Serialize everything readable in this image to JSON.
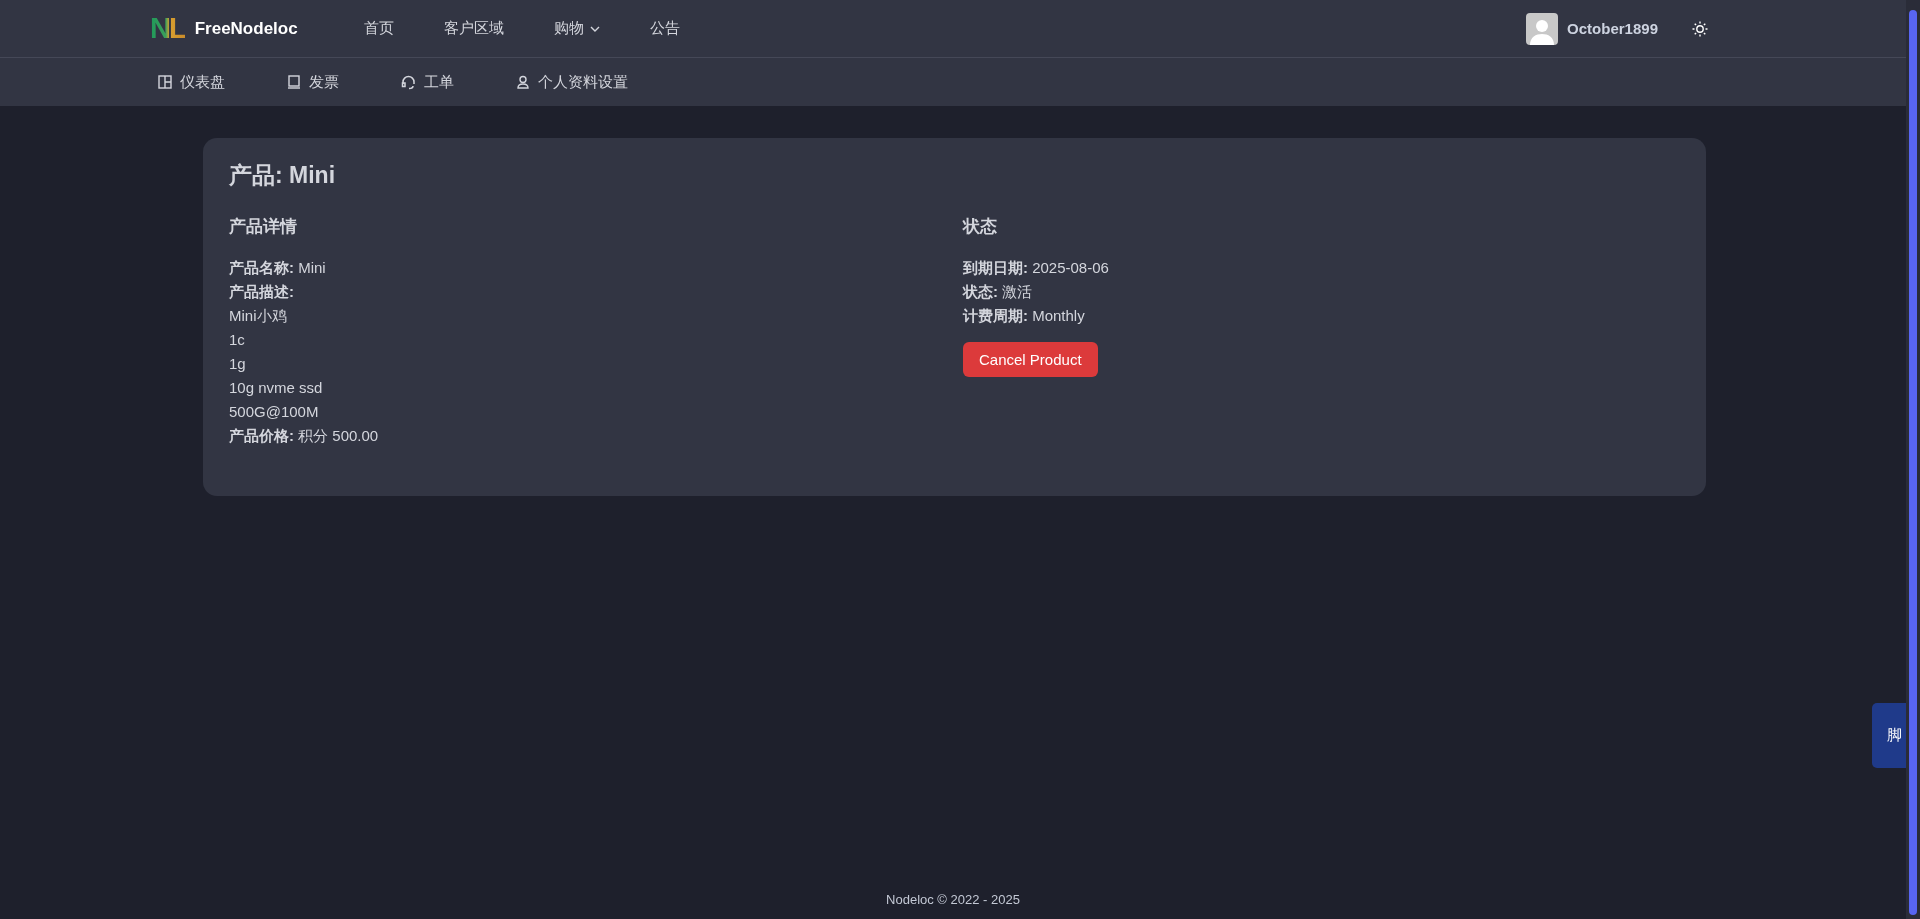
{
  "header": {
    "logo_mark": "NL",
    "brand": "FreeNodeloc",
    "nav": [
      {
        "label": "首页",
        "dropdown": false
      },
      {
        "label": "客户区域",
        "dropdown": false
      },
      {
        "label": "购物",
        "dropdown": true
      },
      {
        "label": "公告",
        "dropdown": false
      }
    ],
    "user": "October1899"
  },
  "subnav": [
    {
      "label": "仪表盘",
      "kind": "dashboard"
    },
    {
      "label": "发票",
      "kind": "invoice"
    },
    {
      "label": "工单",
      "kind": "headset"
    },
    {
      "label": "个人资料设置",
      "kind": "user"
    }
  ],
  "product": {
    "title": "产品: Mini",
    "details": {
      "heading": "产品详情",
      "lines": [
        "**产品名称:** Mini",
        "**产品描述:**",
        "Mini小鸡",
        "1c",
        "1g",
        "10g nvme ssd",
        "500G@100M",
        "**产品价格:** 积分 500.00"
      ]
    },
    "status": {
      "heading": "状态",
      "lines": [
        "**到期日期:** 2025-08-06",
        "**状态:** 激活",
        "**计费周期:** Monthly"
      ],
      "button": "Cancel Product"
    }
  },
  "side_tab": "脚",
  "footer": "Nodeloc © 2022 - 2025"
}
